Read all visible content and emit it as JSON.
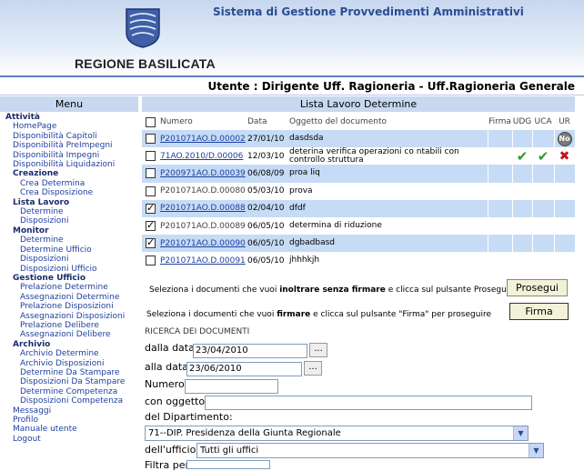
{
  "header": {
    "app_title": "Sistema di Gestione Provvedimenti Amministrativi",
    "region_name": "REGIONE BASILICATA",
    "user_line": "Utente : Dirigente Uff. Ragioneria - Uff.Ragioneria Generale"
  },
  "sidebar": {
    "title": "Menu",
    "items": [
      {
        "type": "group",
        "label": "Attività"
      },
      {
        "type": "link",
        "label": "HomePage"
      },
      {
        "type": "link",
        "label": "Disponibilità Capitoli"
      },
      {
        "type": "link",
        "label": "Disponibilità PreImpegni"
      },
      {
        "type": "link",
        "label": "Disponibilità Impegni"
      },
      {
        "type": "link",
        "label": "Disponibilità Liquidazioni"
      },
      {
        "type": "sub",
        "label": "Creazione"
      },
      {
        "type": "link2",
        "label": "Crea Determina"
      },
      {
        "type": "link2",
        "label": "Crea Disposizione"
      },
      {
        "type": "sub",
        "label": "Lista Lavoro"
      },
      {
        "type": "link2",
        "label": "Determine"
      },
      {
        "type": "link2",
        "label": "Disposizioni"
      },
      {
        "type": "sub",
        "label": "Monitor"
      },
      {
        "type": "link2",
        "label": "Determine"
      },
      {
        "type": "link2",
        "label": "Determine Ufficio"
      },
      {
        "type": "link2",
        "label": "Disposizioni"
      },
      {
        "type": "link2",
        "label": "Disposizioni Ufficio"
      },
      {
        "type": "sub",
        "label": "Gestione Ufficio"
      },
      {
        "type": "link2",
        "label": "Prelazione Determine"
      },
      {
        "type": "link2",
        "label": "Assegnazioni Determine"
      },
      {
        "type": "link2",
        "label": "Prelazione Disposizioni"
      },
      {
        "type": "link2",
        "label": "Assegnazioni Disposizioni"
      },
      {
        "type": "link2",
        "label": "Prelazione Delibere"
      },
      {
        "type": "link2",
        "label": "Assegnazioni Delibere"
      },
      {
        "type": "sub",
        "label": "Archivio"
      },
      {
        "type": "link2",
        "label": "Archivio Determine"
      },
      {
        "type": "link2",
        "label": "Archivio Disposizioni"
      },
      {
        "type": "link2",
        "label": "Determine Da Stampare"
      },
      {
        "type": "link2",
        "label": "Disposizioni Da Stampare"
      },
      {
        "type": "link2",
        "label": "Determine Competenza"
      },
      {
        "type": "link2",
        "label": "Disposizioni Competenza"
      },
      {
        "type": "link",
        "label": "Messaggi"
      },
      {
        "type": "link",
        "label": "Profilo"
      },
      {
        "type": "link",
        "label": "Manuale utente"
      },
      {
        "type": "link",
        "label": "Logout"
      }
    ]
  },
  "main": {
    "title": "Lista Lavoro Determine",
    "columns": {
      "numero": "Numero",
      "data": "Data",
      "oggetto": "Oggetto del documento",
      "firma": "Firma",
      "udg": "UDG",
      "uca": "UCA",
      "ur": "UR"
    },
    "rows": [
      {
        "checked": false,
        "numero": "P201071AO.D.00002",
        "linked": true,
        "data": "27/01/10",
        "oggetto": "dasdsda",
        "alt": true,
        "ur": "No"
      },
      {
        "checked": false,
        "numero": "71AO.2010/D.00006",
        "linked": true,
        "data": "12/03/10",
        "oggetto": "deterina verifica operazioni co ntabili con controllo struttura",
        "alt": false,
        "udg": "tick",
        "uca": "tick",
        "ur": "cross"
      },
      {
        "checked": false,
        "numero": "P200971AO.D.00039",
        "linked": true,
        "data": "06/08/09",
        "oggetto": "proa liq",
        "alt": true
      },
      {
        "checked": false,
        "numero": "P201071AO.D.00080",
        "linked": false,
        "data": "05/03/10",
        "oggetto": "prova",
        "alt": false
      },
      {
        "checked": true,
        "numero": "P201071AO.D.00088",
        "linked": true,
        "data": "02/04/10",
        "oggetto": "dfdf",
        "alt": true
      },
      {
        "checked": true,
        "numero": "P201071AO.D.00089",
        "linked": false,
        "data": "06/05/10",
        "oggetto": "determina di riduzione",
        "alt": false
      },
      {
        "checked": true,
        "numero": "P201071AO.D.00090",
        "linked": true,
        "data": "06/05/10",
        "oggetto": "dgbadbasd",
        "alt": true
      },
      {
        "checked": false,
        "numero": "P201071AO.D.00091",
        "linked": true,
        "data": "06/05/10",
        "oggetto": "jhhhkjh",
        "alt": false
      }
    ],
    "forward_text_1": "Seleziona i documenti che vuoi ",
    "forward_text_bold": "inoltrare senza firmare",
    "forward_text_2": " e clicca sul pulsante Prosegui",
    "forward_button": "Prosegui",
    "sign_text_1": "Seleziona i documenti che vuoi ",
    "sign_text_bold": "firmare",
    "sign_text_2": " e clicca sul pulsante \"Firma\" per proseguire",
    "sign_button": "Firma"
  },
  "search": {
    "title": "RICERCA DEI DOCUMENTI",
    "from_label": "dalla data",
    "from_value": "23/04/2010",
    "to_label": "alla data",
    "to_value": "23/06/2010",
    "dots": "...",
    "numero_label": "Numero",
    "numero_value": "",
    "oggetto_label": "con oggetto",
    "oggetto_value": "",
    "dept_label": "del Dipartimento:",
    "dept_value": "71--DIP. Presidenza della Giunta Regionale",
    "office_label": "dell'ufficio:",
    "office_value": "Tutti gli uffici",
    "filter_label": "Filtra per:"
  },
  "colors": {
    "accent": "#2b4d92",
    "row_alt": "#c6dbf5",
    "bar": "#c8d8f0"
  }
}
